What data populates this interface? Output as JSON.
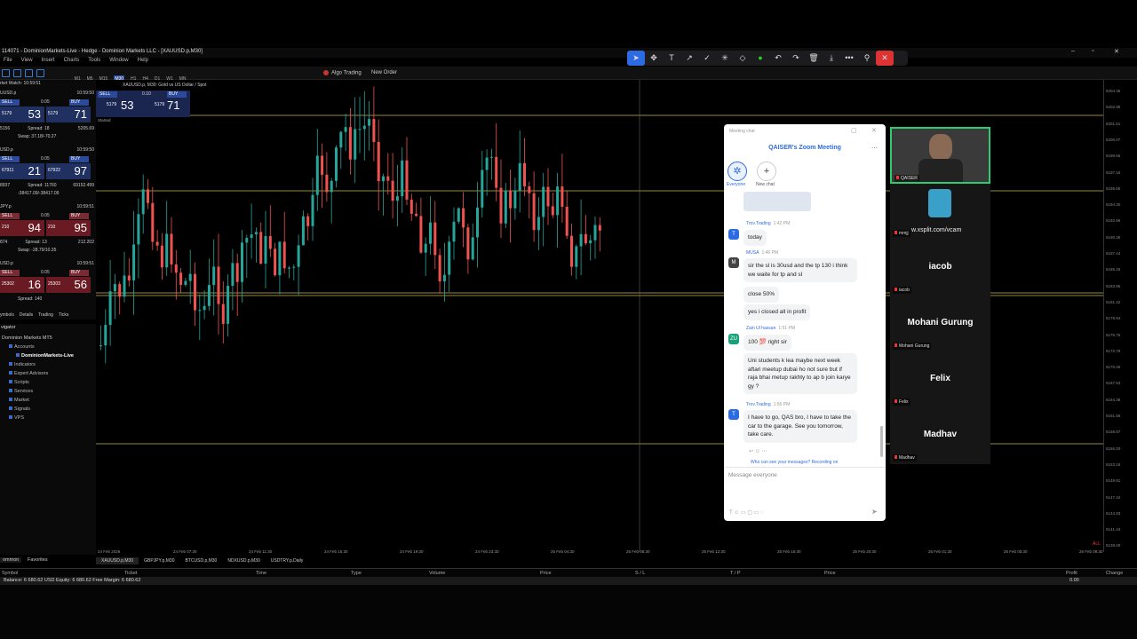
{
  "window": {
    "title": "114071 - DominionMarkets-Live - Hedge - Dominion Markets LLC - [XAUUSD.p,M30]"
  },
  "menu": [
    "File",
    "View",
    "Insert",
    "Charts",
    "Tools",
    "Window",
    "Help"
  ],
  "toolbar": {
    "algo_label": "Algo Trading",
    "new_order_label": "New Order",
    "timeframes": [
      "M1",
      "M5",
      "M15",
      "M30",
      "H1",
      "H4",
      "D1",
      "W1",
      "MN"
    ]
  },
  "market_watch": {
    "header": "rket Watch: 10:59:51",
    "symbols": [
      {
        "name": "UUSD.p",
        "time": "10:59:50",
        "lot": "0.05",
        "bid": "53",
        "bid_pre": "5179",
        "ask": "71",
        "ask_pre": "5179",
        "low": "5156",
        "high": "5205.69",
        "spread": "Spread: 18",
        "swap": "Swap: 37.18/-70.27"
      },
      {
        "name": "USD.p",
        "time": "10:59:50",
        "lot": "0.05",
        "bid": "21",
        "bid_pre": "67911",
        "ask": "97",
        "ask_pre": "67922",
        "low": "8937",
        "high": "69152.499",
        "spread": "Spread: 11760",
        "swap": "-38417.09/-38417.09"
      },
      {
        "name": "JPY.p",
        "time": "10:59:51",
        "lot": "0.05",
        "bid": "94",
        "bid_pre": "210",
        "ask": "95",
        "ask_pre": "210",
        "low": "874",
        "high": "212.202",
        "spread": "Spread: 13",
        "swap": "Swap: -28.79/10.35"
      },
      {
        "name": "USD.p",
        "time": "10:59:51",
        "lot": "0.05",
        "bid": "16",
        "bid_pre": "25302",
        "ask": "56",
        "ask_pre": "25303",
        "low": "",
        "high": "",
        "spread": "Spread: 140",
        "swap": ""
      }
    ],
    "tabs": [
      "ymbols",
      "Details",
      "Trading",
      "Ticks"
    ]
  },
  "navigator": {
    "header": "vigator",
    "root": "Dominion Markets MT5",
    "items": [
      "Accounts",
      "DominionMarkets-Live",
      "Indicators",
      "Expert Advisors",
      "Scripts",
      "Services",
      "Market",
      "Signals",
      "VPS"
    ],
    "tabs": [
      "ommon",
      "Favorites"
    ]
  },
  "chart": {
    "symbol_label": "XAUUSD.p, M30: Gold vs US Dollar / Spot",
    "sell_label": "SELL",
    "buy_label": "BUY",
    "lot": "0.10",
    "bid_pre": "5179",
    "bid": "53",
    "ask_pre": "5179",
    "ask": "71",
    "started": "Started"
  },
  "price_axis": [
    "5204.36",
    "5202.96",
    "5201.51",
    "5200.07",
    "5199.65",
    "5197.15",
    "5195.65",
    "5194.30",
    "5192.96",
    "5190.35",
    "5187.44",
    "5185.25",
    "5183.96",
    "5181.42",
    "5178.94",
    "5175.76",
    "5172.79",
    "5170.46",
    "5167.53",
    "5164.38",
    "5161.55",
    "5158.87",
    "5156.00",
    "5153.18",
    "5149.91",
    "5147.34",
    "5144.93",
    "5141.44",
    "5138.60"
  ],
  "time_axis": [
    "24 Feb 2026",
    "24 Feb 07:30",
    "24 Feb 11:30",
    "24 Feb 15:30",
    "24 Feb 19:30",
    "24 Feb 23:30",
    "25 Feb 04:30",
    "25 Feb 08:30",
    "25 Feb 12:30",
    "25 Feb 16:30",
    "25 Feb 20:30",
    "26 Feb 01:30",
    "26 Feb 05:30",
    "26 Feb 09:30"
  ],
  "chart_tabs": [
    "XAUUSD.p,M30",
    "GBPJPY.p,M30",
    "BTCUSD.p,M30",
    "NDXUSD.p,M30",
    "USDTRY.p,Daily"
  ],
  "trade": {
    "headers": [
      "Symbol",
      "Ticket",
      "Time",
      "Type",
      "Volume",
      "Price",
      "S / L",
      "T / P",
      "Price",
      "Profit",
      "Change"
    ],
    "balance": "Balance: 6 680.62 USD  Equity: 6 680.62  Free Margin: 6 680.62",
    "profit": "0.00"
  },
  "chat": {
    "window": "Meeting chat",
    "title": "QAISER's Zoom Meeting",
    "tab_everyone": "Everyone",
    "tab_new": "New chat",
    "messages": [
      {
        "name": "Trov.Trading",
        "time": "1:42 PM",
        "lines": [
          "today"
        ]
      },
      {
        "name": "MUSA",
        "time": "1:46 PM",
        "lines": [
          "sir the sl is 30usd and the tp 130 i think we waite for tp and sl",
          "close 50%",
          "yes i closed all in  profit"
        ]
      },
      {
        "name": "Zain Ul hassan",
        "time": "1:51 PM",
        "lines": [
          "100 💯 right sir",
          "Uni students k lea maybe next week aftari  meetup dubai ho not sure but if raja bhai metup rakhty to ap b join karye gy ?"
        ]
      },
      {
        "name": "Trov.Trading",
        "time": "1:56 PM",
        "lines": [
          "I have to go, QAS bro, I have to take the car to the garage. See you tomorrow, take care."
        ]
      }
    ],
    "note": "Who can see your messages? Recording on",
    "placeholder": "Message everyone"
  },
  "participants": [
    {
      "name": "QAISER",
      "big": ""
    },
    {
      "name": "mmjj",
      "big": "w.xsplit.com/vcam"
    },
    {
      "name": "iacob",
      "big": "iacob"
    },
    {
      "name": "Mohani Gurung",
      "big": "Mohani Gurung"
    },
    {
      "name": "Felix",
      "big": "Felix"
    },
    {
      "name": "Madhav",
      "big": "Madhav"
    }
  ],
  "colors": {
    "bull": "#26a69a",
    "bear": "#ef5350",
    "level": "#c9b458",
    "chat_accent": "#2d6be3"
  }
}
